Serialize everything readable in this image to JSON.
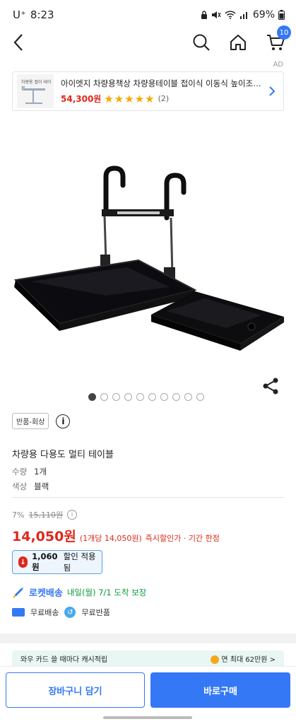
{
  "status_bar": {
    "carrier": "U⁺",
    "time": "8:23",
    "battery": "69%"
  },
  "nav": {
    "cart_count": "10"
  },
  "ad": {
    "label": "AD",
    "thumb_text": "차량용 접이 테이블",
    "title": "아이엣지 차량용책상 차량용테이블 접이식 이동식 높이조절 각도조...",
    "price": "54,300원",
    "stars": "★★★★★",
    "review_count": "(2)"
  },
  "gallery": {
    "image_count": 10,
    "active_index": 0
  },
  "product": {
    "return_badge": "반품-회상",
    "info_icon": "i",
    "title": "차량용 다용도 멀티 테이블",
    "options": [
      {
        "key": "수량",
        "value": "1개"
      },
      {
        "key": "색상",
        "value": "블랙"
      }
    ]
  },
  "pricing": {
    "discount_rate": "7%",
    "original_price": "15,110원",
    "sale_price": "14,050원",
    "unit_price": "(1개당 14,050원)",
    "deal_note": "즉시할인가 · 기간 한정",
    "discount_badge": "1,060원",
    "discount_badge_suffix": "할인 적용됨"
  },
  "delivery": {
    "rocket_label": "로켓배송",
    "eta": "내일(월) 7/1 도착 보장",
    "free_shipping": "무료배송",
    "free_return": "무료반품"
  },
  "promo": {
    "left": "와우 카드 쓸 때마다 캐시적립",
    "right": "연 최대 62만원 >"
  },
  "actions": {
    "add_to_cart": "장바구니 담기",
    "buy_now": "바로구매"
  },
  "colors": {
    "accent": "#3478f6",
    "price_red": "#e0271a",
    "rocket_green": "#0a9a3a"
  }
}
